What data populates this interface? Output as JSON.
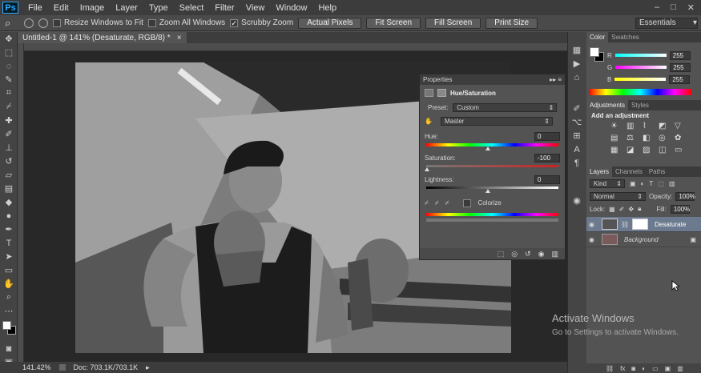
{
  "app": {
    "logo": "Ps"
  },
  "menu": [
    "File",
    "Edit",
    "Image",
    "Layer",
    "Type",
    "Select",
    "Filter",
    "View",
    "Window",
    "Help"
  ],
  "window_controls": [
    "–",
    "□",
    "✕"
  ],
  "options": {
    "zoom_icon_glyph": "⌕",
    "resize_windows_label": "Resize Windows to Fit",
    "zoom_all_label": "Zoom All Windows",
    "scrubby_zoom_label": "Scrubby Zoom",
    "actual_pixels_label": "Actual Pixels",
    "fit_screen_label": "Fit Screen",
    "fill_screen_label": "Fill Screen",
    "print_size_label": "Print Size",
    "workspace": "Essentials"
  },
  "document": {
    "tab_title": "Untitled-1 @ 141% (Desaturate, RGB/8) *",
    "close_glyph": "×"
  },
  "status": {
    "zoom": "141.42%",
    "doc": "Doc: 703.1K/703.1K"
  },
  "properties": {
    "title": "Properties",
    "subtitle": "Hue/Saturation",
    "preset_label": "Preset:",
    "preset_value": "Custom",
    "channel": "Master",
    "hue_label": "Hue:",
    "hue_value": "0",
    "saturation_label": "Saturation:",
    "saturation_value": "-100",
    "lightness_label": "Lightness:",
    "lightness_value": "0",
    "colorize_label": "Colorize"
  },
  "color_panel": {
    "tabs": [
      "Color",
      "Swatches"
    ],
    "r_label": "R",
    "r_value": "255",
    "g_label": "G",
    "g_value": "255",
    "b_label": "B",
    "b_value": "255"
  },
  "adjustments": {
    "tabs": [
      "Adjustments",
      "Styles"
    ],
    "heading": "Add an adjustment"
  },
  "layers": {
    "tabs": [
      "Layers",
      "Channels",
      "Paths"
    ],
    "filter": "Kind",
    "blend_mode": "Normal",
    "opacity_label": "Opacity:",
    "opacity_value": "100%",
    "lock_label": "Lock:",
    "fill_label": "Fill:",
    "fill_value": "100%",
    "items": [
      {
        "name": "Desaturate"
      },
      {
        "name": "Background"
      }
    ]
  },
  "watermark": {
    "line1": "Activate Windows",
    "line2": "Go to Settings to activate Windows."
  },
  "colors": {
    "accent": "#31a8ff",
    "chrome": "#535353"
  }
}
